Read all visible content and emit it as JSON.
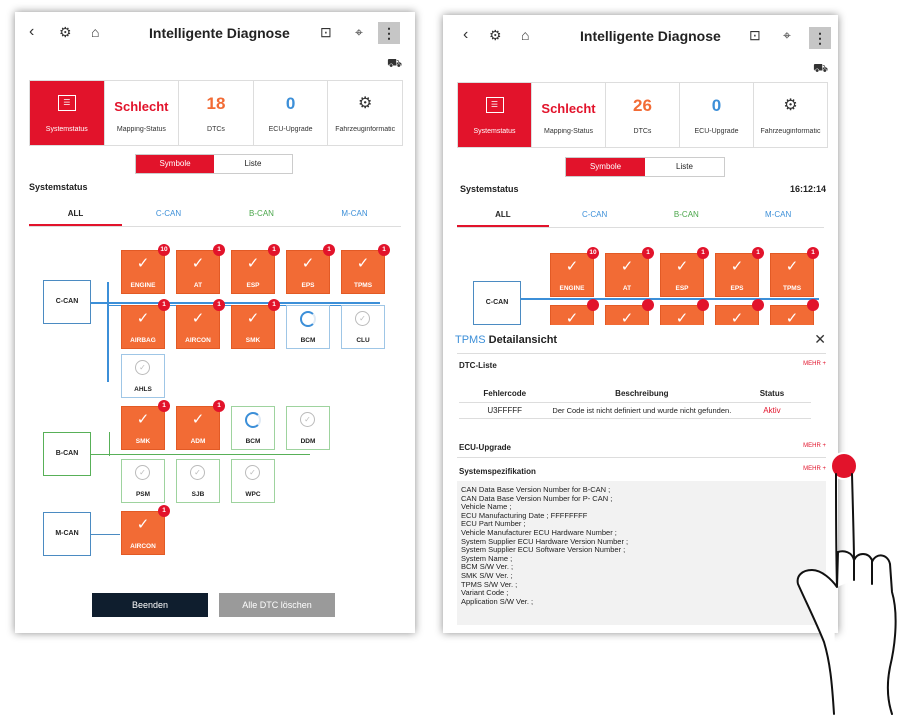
{
  "left_screen": {
    "title": "Intelligente Diagnose",
    "tiles": [
      {
        "value": "",
        "label": "Systemstatus"
      },
      {
        "value": "Schlecht",
        "label": "Mapping-Status"
      },
      {
        "value": "18",
        "label": "DTCs"
      },
      {
        "value": "0",
        "label": "ECU-Upgrade"
      },
      {
        "value": "",
        "label": "Fahrzeuginformatic"
      }
    ],
    "view_toggle": {
      "symbols": "Symbole",
      "list": "Liste"
    },
    "section_title": "Systemstatus",
    "tabs": [
      "ALL",
      "C-CAN",
      "B-CAN",
      "M-CAN"
    ],
    "buses": [
      "C-CAN",
      "B-CAN",
      "M-CAN"
    ],
    "ecus": [
      {
        "name": "ENGINE",
        "status": "error",
        "count": "10"
      },
      {
        "name": "AT",
        "status": "error",
        "count": "1"
      },
      {
        "name": "ESP",
        "status": "error",
        "count": "1"
      },
      {
        "name": "EPS",
        "status": "error",
        "count": "1"
      },
      {
        "name": "TPMS",
        "status": "error",
        "count": "1"
      },
      {
        "name": "AIRBAG",
        "status": "error",
        "count": "1"
      },
      {
        "name": "AIRCON",
        "status": "error",
        "count": "1"
      },
      {
        "name": "SMK",
        "status": "error",
        "count": "1"
      },
      {
        "name": "BCM",
        "status": "loading"
      },
      {
        "name": "CLU",
        "status": "ok"
      },
      {
        "name": "AHLS",
        "status": "ok"
      },
      {
        "name": "SMK",
        "status": "error",
        "count": "1"
      },
      {
        "name": "ADM",
        "status": "error",
        "count": "1"
      },
      {
        "name": "BCM",
        "status": "loading"
      },
      {
        "name": "DDM",
        "status": "ok"
      },
      {
        "name": "PSM",
        "status": "ok"
      },
      {
        "name": "SJB",
        "status": "ok"
      },
      {
        "name": "WPC",
        "status": "ok"
      },
      {
        "name": "AIRCON",
        "status": "error",
        "count": "1"
      }
    ],
    "buttons": {
      "end": "Beenden",
      "clear": "Alle DTC löschen"
    }
  },
  "right_screen": {
    "title": "Intelligente Diagnose",
    "tiles": [
      {
        "value": "",
        "label": "Systemstatus"
      },
      {
        "value": "Schlecht",
        "label": "Mapping-Status"
      },
      {
        "value": "26",
        "label": "DTCs"
      },
      {
        "value": "0",
        "label": "ECU-Upgrade"
      },
      {
        "value": "",
        "label": "Fahrzeuginformatic"
      }
    ],
    "view_toggle": {
      "symbols": "Symbole",
      "list": "Liste"
    },
    "section_title": "Systemstatus",
    "time": "16:12:14",
    "tabs": [
      "ALL",
      "C-CAN",
      "B-CAN",
      "M-CAN"
    ],
    "bus": "C-CAN",
    "ecus": [
      {
        "name": "ENGINE",
        "count": "10"
      },
      {
        "name": "AT",
        "count": "1"
      },
      {
        "name": "ESP",
        "count": "1"
      },
      {
        "name": "EPS",
        "count": "1"
      },
      {
        "name": "TPMS",
        "count": "1"
      }
    ],
    "detail": {
      "title_accent": "TPMS",
      "title_rest": " Detailansicht",
      "dtc_list": "DTC-Liste",
      "more": "MEHR +",
      "columns": [
        "Fehlercode",
        "Beschreibung",
        "Status"
      ],
      "row": {
        "code": "U3FFFFF",
        "desc": "Der Code ist nicht definiert und wurde nicht gefunden.",
        "status": "Aktiv"
      },
      "ecu_upgrade": "ECU-Upgrade",
      "specs_title": "Systemspezifikation",
      "specs": [
        "CAN Data Base Version Number for B-CAN ;",
        "CAN Data Base Version Number for P- CAN ;",
        "Vehicle Name ;",
        "ECU Manufacturing Date ; FFFFFFFF",
        "ECU Part Number ;",
        "Vehicle Manufacturer ECU Hardware Number ;",
        "System Supplier ECU Hardware Version Number ;",
        "System Supplier ECU Software Version Number ;",
        "System Name ;",
        "BCM S/W Ver. ;",
        "SMK S/W Ver. ;",
        "TPMS S/W Ver. ;",
        "Variant Code ;",
        "Application S/W Ver. ;"
      ]
    }
  },
  "colors": {
    "accent_red": "#e2132b",
    "error_orange": "#f26b35",
    "c_can_blue": "#3c8fd8",
    "b_can_green": "#4aa64a"
  }
}
